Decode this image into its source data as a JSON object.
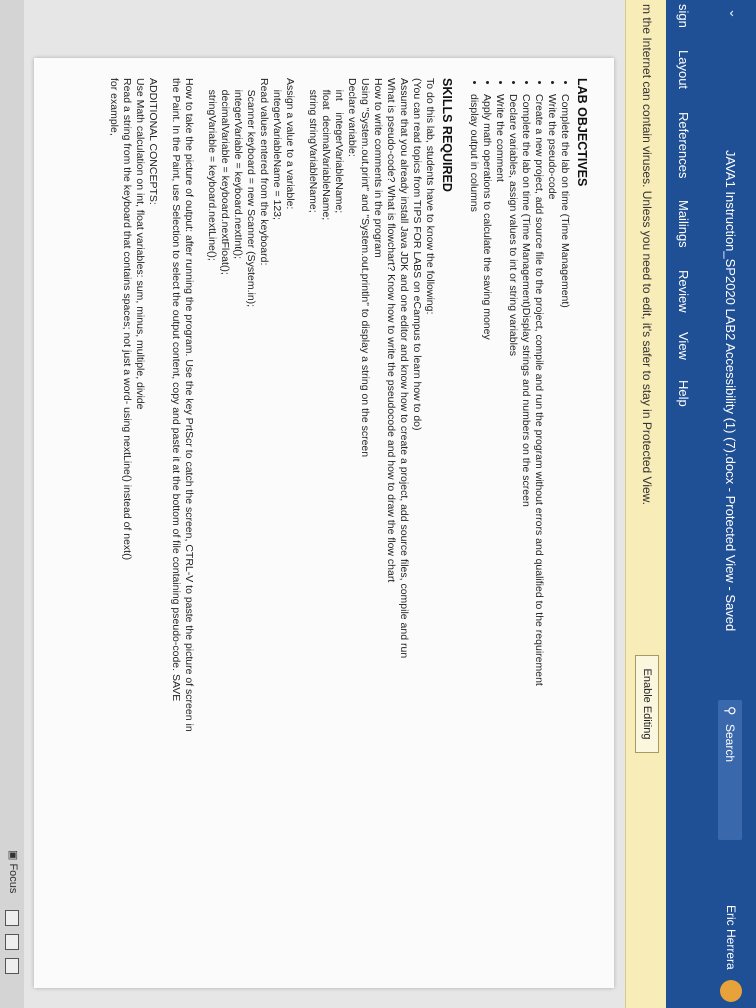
{
  "window": {
    "title": "JAVA1 Instruction_SP2020 LAB2 Accessibility (1) (7).docx  -  Protected View  -  Saved",
    "search_label": "Search",
    "user": "Eric Herrera"
  },
  "ribbon": {
    "tabs": [
      "sign",
      "Layout",
      "References",
      "Mailings",
      "Review",
      "View",
      "Help"
    ]
  },
  "protected_view": {
    "message": "m the Internet can contain viruses. Unless you need to edit, it's safer to stay in Protected View.",
    "button": "Enable Editing"
  },
  "document": {
    "objectives_heading": "LAB OBJECTIVES",
    "objectives": [
      "Complete the lab on time (Time Management)",
      "Write the pseudo-code",
      "Create a new project, add source file to the project, compile and run the program without errors and qualified to the requirement",
      "Complete the lab on time (Time Management)Display strings and numbers on the screen",
      "Declare variables, assign values to int or string variables",
      "Write the comment",
      "Apply math operations to calculate the saving money",
      "display output in columns"
    ],
    "skills_heading": "SKILLS REQUIRED",
    "skills_text": "To do this lab, students have to know the following:\n(You can read topics from TIPS FOR LABS on eCampus to learn how to do)\nAssume that you already install Java JDK and one editor and know how to create a project, add source files, compile and run\nWhat is pseudo-code? What is flowchart? Know how to write the pseudocode and how to draw the flow chart\nHow to write comments in the program\nUsing \"System.out.print\" and \"System.out.println\" to display a string on the screen\nDeclare variable:\n    int    integerVariableName;\n    float  decimalVariableName;\n    string stringVariableName;",
    "assign_text": "Assign a value to a variable:\n    integerVariableName = 123;\nRead values entered from the keyboard:\n    Scanner keyboard = new Scanner (System.in);\n    integerVariable = keyboard.nextInt();\n    decimalVariable = keyboard.nextFloat();\n    stringVariable = keyboard.nextLine();",
    "output_text": "How to take the picture of output: after running the program. Use the key PrtScr to catch the screen, CTRL-V to paste the picture of screen in the Paint. In the Paint, use Selection to select the output content, copy and paste it at the bottom of file containing pseudo-code. SAVE",
    "additional_text": "ADDITIONAL CONCEPTS:\nUse Math calculation on int, float variables: sum, minus, multiple, divide\nRead a string from the keyboard that contains spaces; not just a word- using nextLine() instead of next()\nfor example,"
  },
  "status": {
    "focus_label": "Focus"
  }
}
